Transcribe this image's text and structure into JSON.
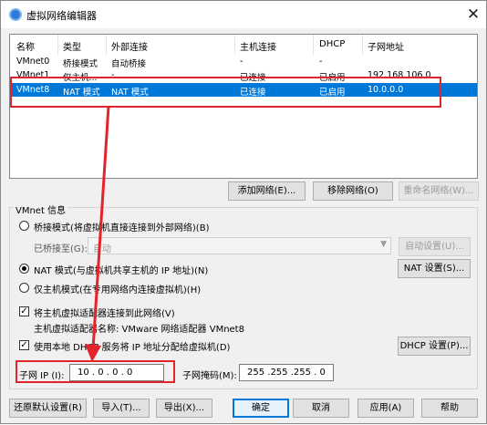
{
  "window": {
    "title": "虚拟网络编辑器",
    "close_glyph": "✕"
  },
  "network_table": {
    "columns": [
      "名称",
      "类型",
      "外部连接",
      "主机连接",
      "DHCP",
      "子网地址"
    ],
    "rows": [
      {
        "name": "VMnet0",
        "type": "桥接模式",
        "external": "自动桥接",
        "host": "-",
        "dhcp": "-",
        "subnet": ""
      },
      {
        "name": "VMnet1",
        "type": "仅主机...",
        "external": "-",
        "host": "已连接",
        "dhcp": "已启用",
        "subnet": "192.168.106.0"
      },
      {
        "name": "VMnet8",
        "type": "NAT 模式",
        "external": "NAT 模式",
        "host": "已连接",
        "dhcp": "已启用",
        "subnet": "10.0.0.0"
      }
    ],
    "selected_row": "VMnet8"
  },
  "list_buttons": {
    "add": "添加网络(E)...",
    "remove": "移除网络(O)",
    "rename": "重命名网络(W)..."
  },
  "vmnet_info": {
    "group_title": "VMnet 信息",
    "bridge_mode": "桥接模式(将虚拟机直接连接到外部网络)(B)",
    "bridged_to_label": "已桥接至(G):",
    "bridged_to_value": "自动",
    "auto_settings": "自动设置(U)...",
    "nat_mode": "NAT 模式(与虚拟机共享主机的 IP 地址)(N)",
    "nat_settings": "NAT 设置(S)...",
    "host_only": "仅主机模式(在专用网络内连接虚拟机)(H)",
    "connect_adapter": "将主机虚拟适配器连接到此网络(V)",
    "adapter_name": "主机虚拟适配器名称: VMware 网络适配器 VMnet8",
    "use_dhcp": "使用本地 DHCP 服务将 IP 地址分配给虚拟机(D)",
    "dhcp_settings": "DHCP 设置(P)...",
    "subnet_ip_label": "子网 IP (I):",
    "subnet_ip_value": "10 . 0 . 0 . 0",
    "subnet_mask_label": "子网掩码(M):",
    "subnet_mask_value": "255 .255 .255 . 0"
  },
  "footer": {
    "restore": "还原默认设置(R)",
    "import": "导入(T)...",
    "export": "导出(X)...",
    "ok": "确定",
    "cancel": "取消",
    "apply": "应用(A)",
    "help": "帮助"
  },
  "colors": {
    "selection": "#0078d7",
    "highlight": "#e3242b"
  }
}
